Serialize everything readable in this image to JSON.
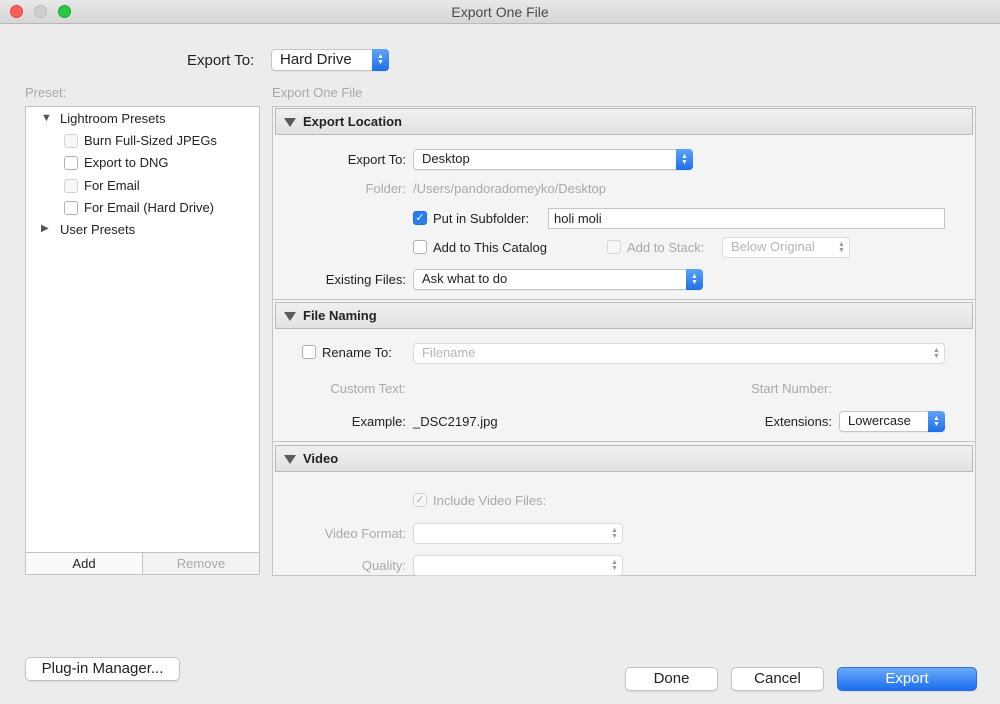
{
  "window": {
    "title": "Export One File"
  },
  "export_to": {
    "label": "Export To:",
    "value": "Hard Drive"
  },
  "preset": {
    "label": "Preset:",
    "tree": [
      {
        "label": "Lightroom Presets",
        "expanded": true
      },
      {
        "label": "Burn Full-Sized JPEGs"
      },
      {
        "label": "Export to DNG"
      },
      {
        "label": "For Email"
      },
      {
        "label": "For Email (Hard Drive)"
      },
      {
        "label": "User Presets",
        "expanded": false
      }
    ],
    "add_label": "Add",
    "remove_label": "Remove"
  },
  "panel_title": "Export One File",
  "export_location": {
    "header": "Export Location",
    "export_to_label": "Export To:",
    "export_to_value": "Desktop",
    "folder_label": "Folder:",
    "folder_path": "/Users/pandoradomeyko/Desktop",
    "put_in_subfolder_label": "Put in Subfolder:",
    "put_in_subfolder_checked": true,
    "subfolder_value": "holi moli",
    "add_to_catalog_label": "Add to This Catalog",
    "add_to_stack_label": "Add to Stack:",
    "stack_value": "Below Original",
    "existing_files_label": "Existing Files:",
    "existing_files_value": "Ask what to do"
  },
  "file_naming": {
    "header": "File Naming",
    "rename_to_label": "Rename To:",
    "rename_to_value": "Filename",
    "custom_text_label": "Custom Text:",
    "start_number_label": "Start Number:",
    "example_label": "Example:",
    "example_value": "_DSC2197.jpg",
    "extensions_label": "Extensions:",
    "extensions_value": "Lowercase"
  },
  "video": {
    "header": "Video",
    "include_video_label": "Include Video Files:",
    "video_format_label": "Video Format:",
    "quality_label": "Quality:"
  },
  "buttons": {
    "plugin_manager": "Plug-in Manager...",
    "done": "Done",
    "cancel": "Cancel",
    "export": "Export"
  },
  "colors": {
    "accent": "#1c6ef0",
    "close": "#fc5f57",
    "minimize": "#cfcfcf",
    "zoom": "#2bc840"
  },
  "icons": {
    "checked": "✓",
    "stepper_up": "▲",
    "stepper_down": "▼",
    "expanded": "▼",
    "collapsed": "▶"
  }
}
